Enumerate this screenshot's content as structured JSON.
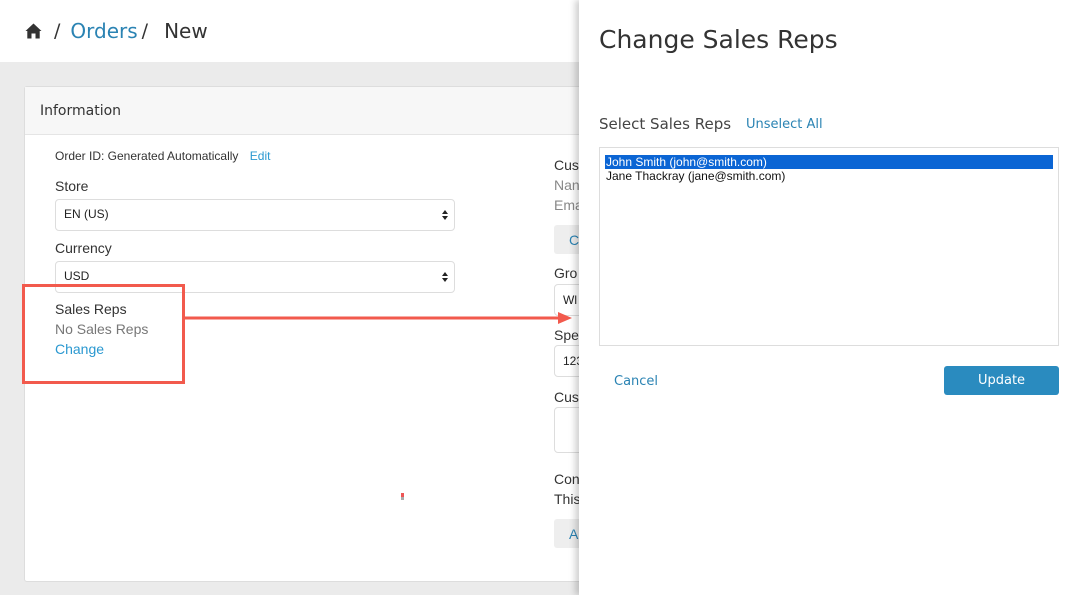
{
  "breadcrumb": {
    "home_icon": "home-icon",
    "separator": "/",
    "parent": "Orders",
    "current": "New"
  },
  "info_panel": {
    "title": "Information",
    "order_id": {
      "text": "Order ID: Generated Automatically",
      "edit_label": "Edit"
    },
    "store": {
      "label": "Store",
      "value": "EN (US)"
    },
    "currency": {
      "label": "Currency",
      "value": "USD"
    },
    "sales_reps": {
      "label": "Sales Reps",
      "value": "No Sales Reps",
      "change_label": "Change"
    },
    "right_column_partial": {
      "customer_label": "Cus",
      "name_label": "Nan",
      "email_label": "Ema",
      "customer_button": "C",
      "group_label": "Gro",
      "group_value": "Wl",
      "special_label": "Spe",
      "special_value": "123",
      "custom_label": "Cus",
      "comment_label": "Con",
      "comment_text": "This",
      "add_button": "A"
    }
  },
  "annotation": {
    "color": "#f25a4d"
  },
  "drawer": {
    "title": "Change Sales Reps",
    "select_label": "Select Sales Reps",
    "unselect_all_label": "Unselect All",
    "reps": [
      {
        "label": "John Smith (john@smith.com)",
        "selected": true
      },
      {
        "label": "Jane Thackray (jane@smith.com)",
        "selected": false
      }
    ],
    "cancel_label": "Cancel",
    "update_label": "Update"
  },
  "colors": {
    "link": "#2a83b3",
    "primary_button": "#2a8bbf",
    "selection": "#0b65d4"
  }
}
